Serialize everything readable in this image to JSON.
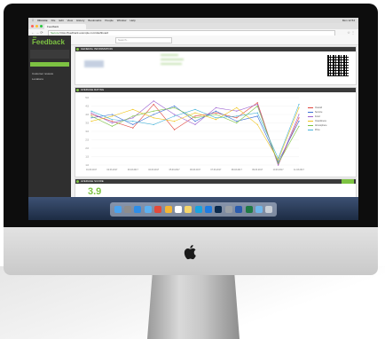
{
  "mac_menu": {
    "app": "Chrome",
    "items": [
      "File",
      "Edit",
      "View",
      "History",
      "Bookmarks",
      "People",
      "Window",
      "Help"
    ],
    "status": "Mon 12:54"
  },
  "browser": {
    "tab_title": "Feedback",
    "url_secure": "Secure",
    "url": "https://feedback.example.com/dashboard",
    "nav_icons": "← → ⟳",
    "menu_icons": "☆ ⋮"
  },
  "app": {
    "logo": "Feedback",
    "logo_tag": "GE",
    "search_placeholder": "Search...",
    "sidebar_items": [
      "Customer reviews",
      "Locations"
    ],
    "panel1_title": "GENERAL INFORMATION",
    "panel2_title": "AVERAGE RATING",
    "panel3_title": "AVERAGE SCORE",
    "score_value": "3.9"
  },
  "chart_data": {
    "type": "line",
    "ylim": [
      1,
      5
    ],
    "y_ticks": [
      "5.0",
      "4.5",
      "4.0",
      "3.5",
      "3.0",
      "2.5",
      "2.0",
      "1.5",
      "1.0"
    ],
    "categories": [
      "01.03.2017",
      "02.03.2017",
      "03.03.2017",
      "04.03.2017",
      "05.03.2017",
      "06.03.2017",
      "07.03.2017",
      "08.03.2017",
      "09.03.2017",
      "10.03.2017",
      "11.03.2017"
    ],
    "series": [
      {
        "name": "Overall",
        "color": "#e0443c",
        "values": [
          4.0,
          3.6,
          3.2,
          4.6,
          3.1,
          3.9,
          4.1,
          3.8,
          4.7,
          1.0,
          3.8
        ]
      },
      {
        "name": "Service",
        "color": "#3b6fd6",
        "values": [
          3.8,
          4.0,
          3.4,
          4.0,
          4.5,
          3.6,
          4.2,
          3.6,
          3.9,
          1.2,
          3.6
        ]
      },
      {
        "name": "Food",
        "color": "#9a5fd0",
        "values": [
          4.1,
          3.5,
          3.8,
          4.8,
          4.0,
          3.4,
          4.4,
          4.2,
          4.6,
          1.0,
          4.0
        ]
      },
      {
        "name": "Cleanliness",
        "color": "#f0c419",
        "values": [
          3.6,
          3.9,
          4.3,
          3.8,
          3.6,
          4.1,
          3.7,
          4.4,
          3.4,
          1.3,
          4.4
        ]
      },
      {
        "name": "Atmosphere",
        "color": "#7dc242",
        "values": [
          3.9,
          3.3,
          3.9,
          4.2,
          4.4,
          3.8,
          4.0,
          3.5,
          4.5,
          1.1,
          3.3
        ]
      },
      {
        "name": "Price",
        "color": "#46b3d9",
        "values": [
          4.2,
          3.7,
          3.6,
          3.4,
          3.9,
          4.3,
          3.8,
          3.9,
          4.1,
          1.4,
          4.6
        ]
      }
    ]
  },
  "colors": {
    "accent": "#7dc242",
    "sidebar": "#2f2f2f"
  }
}
